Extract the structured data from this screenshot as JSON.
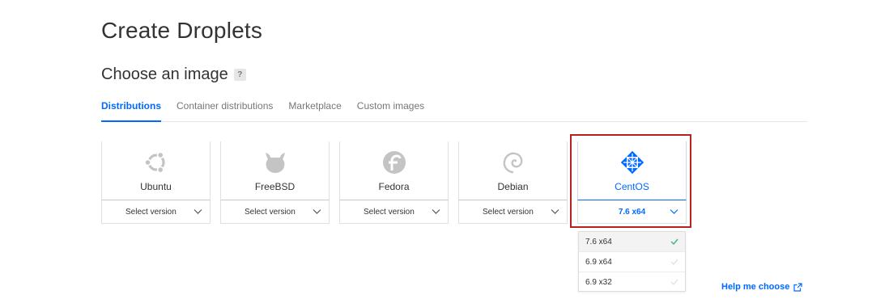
{
  "page": {
    "title": "Create Droplets"
  },
  "section": {
    "title": "Choose an image",
    "help_icon": "?"
  },
  "tabs": [
    {
      "label": "Distributions",
      "active": true
    },
    {
      "label": "Container distributions",
      "active": false
    },
    {
      "label": "Marketplace",
      "active": false
    },
    {
      "label": "Custom images",
      "active": false
    }
  ],
  "distributions": [
    {
      "name": "Ubuntu",
      "icon": "ubuntu-icon",
      "version": "Select version",
      "selected": false
    },
    {
      "name": "FreeBSD",
      "icon": "freebsd-icon",
      "version": "Select version",
      "selected": false
    },
    {
      "name": "Fedora",
      "icon": "fedora-icon",
      "version": "Select version",
      "selected": false
    },
    {
      "name": "Debian",
      "icon": "debian-icon",
      "version": "Select version",
      "selected": false
    },
    {
      "name": "CentOS",
      "icon": "centos-icon",
      "version": "7.6 x64",
      "selected": true
    }
  ],
  "version_dropdown": {
    "options": [
      {
        "label": "7.6 x64",
        "selected": true
      },
      {
        "label": "6.9 x64",
        "selected": false
      },
      {
        "label": "6.9 x32",
        "selected": false
      }
    ]
  },
  "help_link": {
    "label": "Help me choose",
    "icon": "external-link-icon"
  },
  "colors": {
    "accent": "#0069ff",
    "highlight": "#b42222",
    "icon_gray": "#c4c4c4",
    "check_green": "#3cb878"
  }
}
